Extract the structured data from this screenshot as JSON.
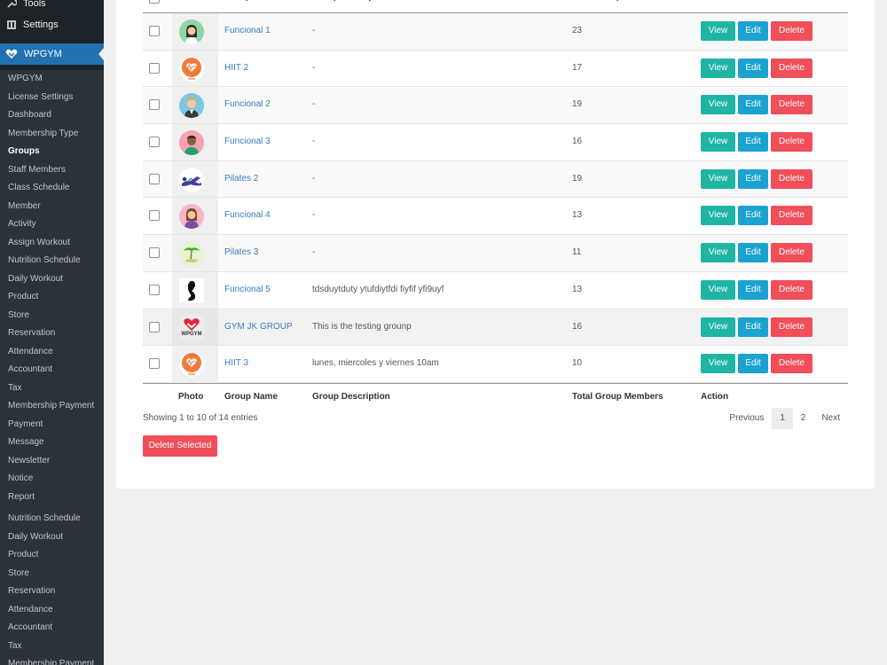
{
  "sidebar": {
    "top_items": [
      {
        "label": "Tools",
        "icon": "wrench-icon"
      },
      {
        "label": "Settings",
        "icon": "settings-icon"
      }
    ],
    "active_menu": {
      "label": "WPGYM",
      "icon": "wpgym-logo-icon"
    },
    "submenu": [
      "WPGYM",
      "License Settings",
      "Dashboard",
      "Membership Type",
      "Groups",
      "Staff Members",
      "Class Schedule",
      "Member",
      "Activity",
      "Assign Workout",
      "Nutrition Schedule",
      "Daily Workout",
      "Product",
      "Store",
      "Reservation",
      "Attendance",
      "Accountant",
      "Tax",
      "Membership Payment",
      "Payment",
      "Message",
      "Newsletter",
      "Notice",
      "Report"
    ],
    "submenu_extra": [
      "Nutrition Schedule",
      "Daily Workout",
      "Product",
      "Store",
      "Reservation",
      "Attendance",
      "Accountant",
      "Tax",
      "Membership Payment"
    ],
    "current": "Groups"
  },
  "table": {
    "columns": {
      "photo": "Photo",
      "name": "Group Name",
      "description": "Group Description",
      "members": "Total Group Members",
      "action": "Action"
    },
    "rows": [
      {
        "name": "Funcional 1",
        "description": "-",
        "members": "23",
        "avatar": "woman-avatar-icon",
        "avatar_bg": "#8ed6a4"
      },
      {
        "name": "HIIT 2",
        "description": "-",
        "members": "17",
        "avatar": "heart-fitness-icon",
        "avatar_bg": "#f2793a"
      },
      {
        "name": "Funcional 2",
        "description": "-",
        "members": "19",
        "avatar": "man-avatar-icon",
        "avatar_bg": "#7fc6e0"
      },
      {
        "name": "Funcional 3",
        "description": "-",
        "members": "16",
        "avatar": "man-dark-avatar-icon",
        "avatar_bg": "#f7a3b1"
      },
      {
        "name": "Pilates 2",
        "description": "-",
        "members": "19",
        "avatar": "pilates-icon",
        "avatar_bg": "#ffffff"
      },
      {
        "name": "Funcional 4",
        "description": "-",
        "members": "13",
        "avatar": "woman-brown-avatar-icon",
        "avatar_bg": "#f7b6c8"
      },
      {
        "name": "Pilates 3",
        "description": "-",
        "members": "11",
        "avatar": "palm-icon",
        "avatar_bg": "#e6f5d0"
      },
      {
        "name": "Funcional 5",
        "description": "tdsduytduty ytufdiytfdi fiyfif yfi9uyf",
        "members": "13",
        "avatar": "arm-silhouette-icon",
        "avatar_bg": "#ffffff"
      },
      {
        "name": "GYM JK GROUP",
        "description": "This is the testing grounp",
        "members": "16",
        "avatar": "wpgym-logo-icon",
        "avatar_bg": "#ececec",
        "logo_text": "WPGYM"
      },
      {
        "name": "HIIT 3",
        "description": "lunes, miercoles y viernes 10am",
        "members": "10",
        "avatar": "heart-fitness-icon",
        "avatar_bg": "#f2793a"
      }
    ],
    "buttons": {
      "view": "View",
      "edit": "Edit",
      "delete": "Delete"
    }
  },
  "footer": {
    "info": "Showing 1 to 10 of 14 entries",
    "pagination": {
      "previous": "Previous",
      "pages": [
        "1",
        "2"
      ],
      "current": "1",
      "next": "Next"
    },
    "delete_selected": "Delete Selected"
  },
  "colors": {
    "view": "#1fb5a4",
    "edit": "#1aa3d1",
    "delete": "#f04e58",
    "link": "#3b7bbf",
    "wp_active": "#2271b1"
  }
}
